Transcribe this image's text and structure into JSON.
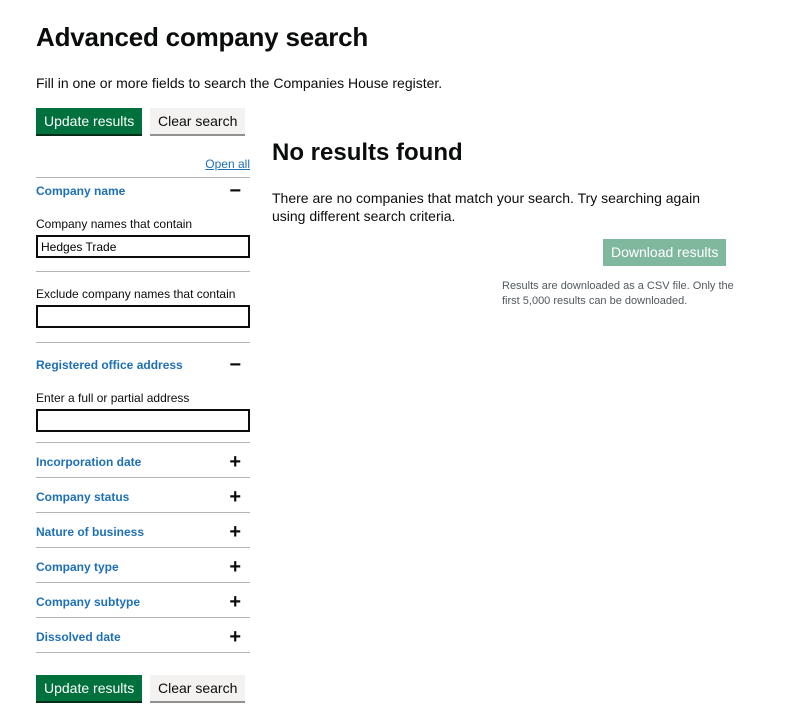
{
  "page_title": "Advanced company search",
  "intro": "Fill in one or more fields to search the Companies House register.",
  "buttons": {
    "update": "Update results",
    "clear": "Clear search"
  },
  "open_all": "Open all",
  "company_name": {
    "heading": "Company name",
    "toggle": "−",
    "contains_label": "Company names that contain",
    "contains_value": "Hedges Trade",
    "exclude_label": "Exclude company names that contain",
    "exclude_value": ""
  },
  "registered_office": {
    "heading": "Registered office address",
    "toggle": "−",
    "address_label": "Enter a full or partial address",
    "address_value": ""
  },
  "collapsed_sections": [
    {
      "heading": "Incorporation date",
      "toggle": "+"
    },
    {
      "heading": "Company status",
      "toggle": "+"
    },
    {
      "heading": "Nature of business",
      "toggle": "+"
    },
    {
      "heading": "Company type",
      "toggle": "+"
    },
    {
      "heading": "Company subtype",
      "toggle": "+"
    },
    {
      "heading": "Dissolved date",
      "toggle": "+"
    }
  ],
  "results": {
    "heading": "No results found",
    "message": "There are no companies that match your search. Try searching again using different search criteria.",
    "download_label": "Download results",
    "download_note": "Results are downloaded as a CSV file. Only the first 5,000 results can be downloaded."
  },
  "colors": {
    "primary_button": "#00703c",
    "link": "#1d70b8",
    "disabled_button": "#80b89e"
  }
}
